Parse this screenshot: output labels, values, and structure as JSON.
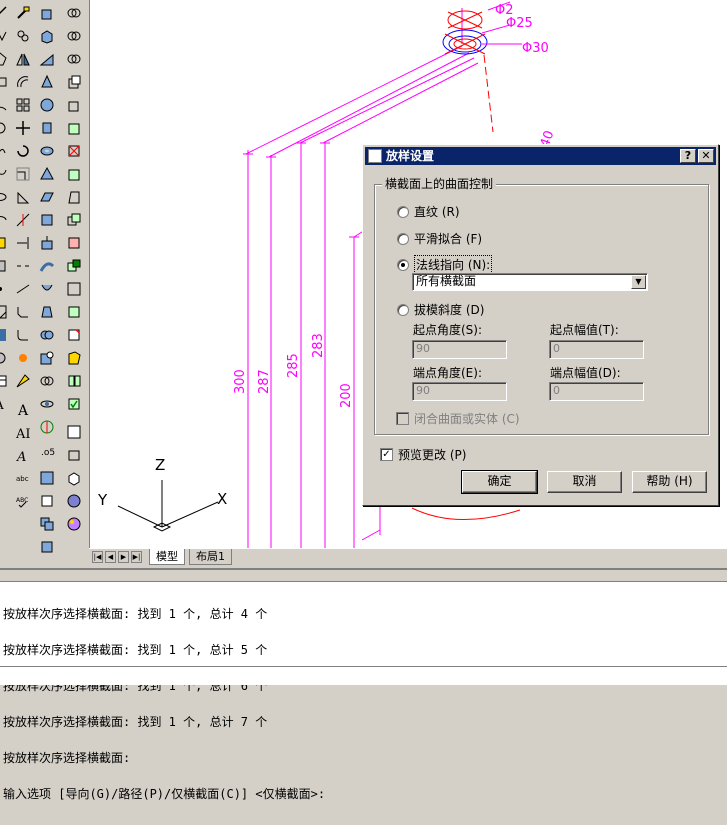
{
  "dialog": {
    "title": "放样设置",
    "help_symbol": "?",
    "close_symbol": "✕",
    "group_label": "横截面上的曲面控制",
    "options": [
      {
        "label": "直纹 (R)",
        "selected": false
      },
      {
        "label": "平滑拟合 (F)",
        "selected": false
      },
      {
        "label": "法线指向 (N):",
        "selected": true
      },
      {
        "label": "拔模斜度 (D)",
        "selected": false
      }
    ],
    "normal_select": "所有横截面",
    "fields": [
      {
        "label": "起点角度(S):",
        "value": "90"
      },
      {
        "label": "起点幅值(T):",
        "value": "0"
      },
      {
        "label": "端点角度(E):",
        "value": "90"
      },
      {
        "label": "端点幅值(D):",
        "value": "0"
      }
    ],
    "close_surface": "闭合曲面或实体 (C)",
    "preview": "预览更改 (P)",
    "ok": "确定",
    "cancel": "取消",
    "help": "帮助 (H)"
  },
  "drawing": {
    "dims": [
      "300",
      "287",
      "285",
      "283",
      "200"
    ],
    "diameters": [
      "Φ25",
      "Φ30",
      "Φ2"
    ],
    "partial_label": "40",
    "axis": {
      "x": "X",
      "y": "Y",
      "z": "Z"
    }
  },
  "tabs": [
    "模型",
    "布局1"
  ],
  "command_lines": [
    "按放样次序选择横截面: 找到 1 个, 总计 4 个",
    "按放样次序选择横截面: 找到 1 个, 总计 5 个",
    "按放样次序选择横截面: 找到 1 个, 总计 6 个",
    "按放样次序选择横截面: 找到 1 个, 总计 7 个",
    "按放样次序选择横截面:",
    "输入选项 [导向(G)/路径(P)/仅横截面(C)] <仅横截面>:"
  ],
  "colors": {
    "dim": "#ff00ff",
    "geometry": "#ff0000",
    "circle": "#0000ff",
    "titlebar": "#0a246a"
  }
}
